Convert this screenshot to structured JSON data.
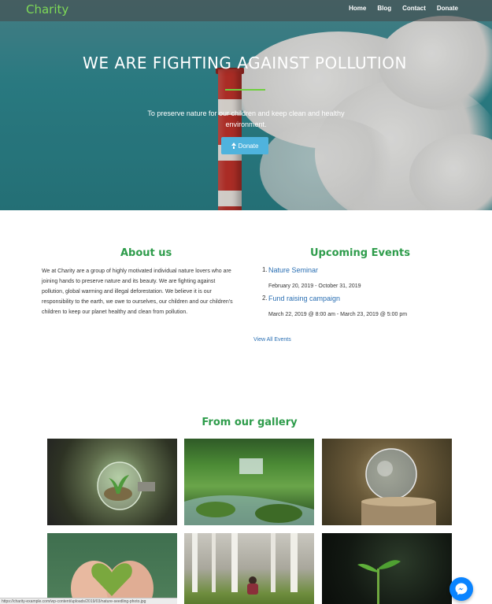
{
  "brand": "Charity",
  "nav": [
    "Home",
    "Blog",
    "Contact",
    "Donate"
  ],
  "hero": {
    "title": "WE ARE FIGHTING AGAINST POLLUTION",
    "subtitle": "To preserve nature for our children and keep clean and healthy environment.",
    "button_label": "Donate",
    "accent_color": "#6fcf3f"
  },
  "about": {
    "title": "About us",
    "text": "We at Charity are a group of highly motivated individual nature lovers who are joining hands to preserve nature and its beauty. We are fighting against pollution, global warming and illegal deforestation. We believe it is our responsibility to the earth, we owe to ourselves, our children and our children's children to keep our planet healthy and clean from pollution."
  },
  "events": {
    "title": "Upcoming Events",
    "items": [
      {
        "num": "1.",
        "name": "Nature Seminar",
        "date": "February 20, 2019 - October 31, 2019"
      },
      {
        "num": "2.",
        "name": "Fund raising campaign",
        "date": "March 22, 2019 @ 8:00 am - March 23, 2019 @ 5:00 pm"
      }
    ],
    "view_all": "View All Events"
  },
  "gallery": {
    "title": "From our gallery",
    "images": [
      "lightbulb-plant",
      "forest-waterfall",
      "glass-ball-on-stump",
      "heart-of-moss-in-hands",
      "person-in-birch-forest",
      "seedling-in-dark"
    ]
  },
  "status_bar": "https://charity-example.com/wp-content/uploads/2019/03/nature-seedling-photo.jpg",
  "colors": {
    "green": "#2e9c4b",
    "link": "#2a6fb3",
    "button": "#4fb3dd",
    "messenger": "#0a84ff"
  }
}
